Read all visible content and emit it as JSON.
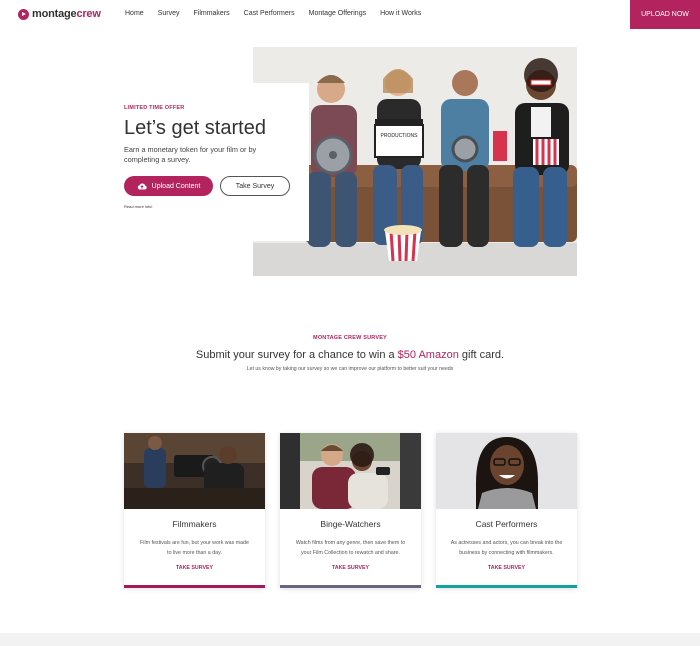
{
  "brand": {
    "part1": "montage",
    "part2": "crew"
  },
  "nav": {
    "links": [
      "Home",
      "Survey",
      "Filmmakers",
      "Cast Performers",
      "Montage Offerings",
      "How it Works"
    ],
    "upload_label": "UPLOAD NOW"
  },
  "hero": {
    "eyebrow": "LIMITED TIME OFFER",
    "title": "Let’s get started",
    "subtitle": "Earn a monetary token for your film or by completing a survey.",
    "primary_button": "Upload Content",
    "secondary_button": "Take Survey",
    "read_more": "Read more info!",
    "slate_text": "PRODUCTIONS"
  },
  "survey": {
    "eyebrow": "MONTAGE CREW SURVEY",
    "title_before": "Submit your survey for a chance to win a ",
    "title_highlight": "$50 Amazon",
    "title_after": " gift card.",
    "subtitle": "Let us know by taking our survey so we can improve our platform to better suit your needs"
  },
  "cards": [
    {
      "title": "Filmmakers",
      "description": "Film festivals are fun, but your work was made to live more than a day.",
      "link": "TAKE SURVEY",
      "accent": "#a3195b"
    },
    {
      "title": "Binge-Watchers",
      "description": "Watch films from any genre, then save them to your Film Collection to rewatch and share.",
      "link": "TAKE SURVEY",
      "accent": "#6b6480"
    },
    {
      "title": "Cast Performers",
      "description": "As actresses and actors, you can break into the business by connecting with filmmakers.",
      "link": "TAKE SURVEY",
      "accent": "#16a09a"
    }
  ],
  "colors": {
    "brand": "#b3245e"
  }
}
